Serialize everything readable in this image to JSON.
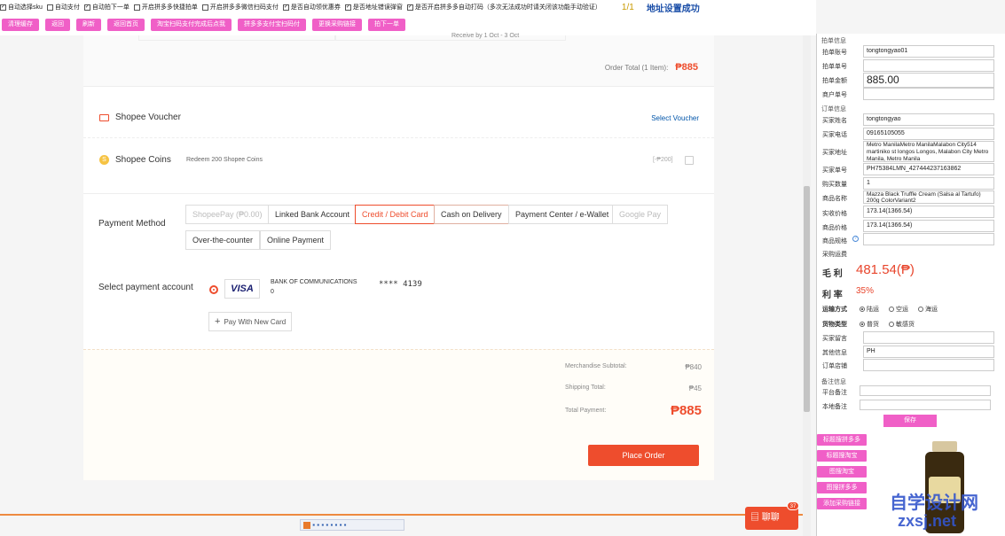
{
  "toolbar": {
    "checkboxes": [
      {
        "label": "自动选择sku",
        "checked": true
      },
      {
        "label": "自动支付",
        "checked": false
      },
      {
        "label": "自动拍下一单",
        "checked": true
      },
      {
        "label": "开启拼多多快捷拍单",
        "checked": false
      },
      {
        "label": "开启拼多多微信扫码支付",
        "checked": false
      },
      {
        "label": "是否自动领优惠券",
        "checked": true
      },
      {
        "label": "是否地址错误弹窗",
        "checked": true
      },
      {
        "label": "是否开启拼多多自动打码（多次无法成功时请关闭该功能手动验证）",
        "checked": true
      }
    ],
    "pager": "1/1",
    "address_status": "地址设置成功",
    "buttons": [
      "清理缓存",
      "返回",
      "刷新",
      "返回首页",
      "淘宝扫码支付完成后点我",
      "拼多多支付宝扫码付",
      "更换采购链接",
      "拍下一单"
    ]
  },
  "order": {
    "receive_text": "Receive by 1 Oct - 3 Oct",
    "order_total_label": "Order Total (1 Item):",
    "order_total_value": "₱885"
  },
  "voucher": {
    "label": "Shopee Voucher",
    "action": "Select Voucher"
  },
  "coins": {
    "label": "Shopee Coins",
    "desc": "Redeem 200 Shopee Coins",
    "value": "[-₱200]"
  },
  "payment": {
    "label": "Payment Method",
    "methods": [
      "ShopeePay (₱0.00)",
      "Linked Bank Account",
      "Credit / Debit Card",
      "Cash on Delivery",
      "Payment Center / e-Wallet",
      "Google Pay",
      "Over-the-counter",
      "Online Payment"
    ],
    "account_label": "Select payment account",
    "card_brand": "VISA",
    "bank_name": "BANK OF COMMUNICATIONS",
    "bank_sub": "0",
    "card_number": "**** 4139",
    "new_card": "Pay With New Card"
  },
  "summary": {
    "merch_label": "Merchandise Subtotal:",
    "merch_value": "₱840",
    "ship_label": "Shipping Total:",
    "ship_value": "₱45",
    "total_label": "Total Payment:",
    "total_value": "₱885",
    "place_order": "Place Order"
  },
  "panel": {
    "sec_order": "拍单信息",
    "account_label": "拍单账号",
    "account_value": "tongtongyao01",
    "order_no_label": "拍单单号",
    "order_no_value": "",
    "amount_label": "拍单金额",
    "amount_value": "885.00",
    "merchant_label": "商户单号",
    "merchant_value": "",
    "sec_buyer": "订单信息",
    "buyer_name_label": "买家姓名",
    "buyer_name_value": "tongtongyao",
    "buyer_phone_label": "买家电话",
    "buyer_phone_value": "09165105055",
    "buyer_addr_label": "买家地址",
    "buyer_addr_value": "Metro ManilaMetro ManilaMalabon City514 martiniko st longos Longos, Malabon City Metro Manila, Metro Manila",
    "buyer_no_label": "买家单号",
    "buyer_no_value": "PH75384LMN_427444237163862",
    "qty_label": "购买数量",
    "qty_value": "1",
    "product_label": "商品名称",
    "product_value": "Mazza Black Truffle Cream (Salsa al Tartufo) 200g ColorVariant2",
    "actual_label": "实收价格",
    "actual_value": "173.14(1366.54)",
    "price_label": "商品价格",
    "price_value": "173.14(1366.54)",
    "spec_label": "商品规格",
    "spec_value": "",
    "freight_label": "采购运费",
    "profit_label": "毛 利",
    "profit_value": "481.54(₱)",
    "rate_label": "利 率",
    "rate_value": "35%",
    "ship_label": "运输方式",
    "ship_options": [
      "陆运",
      "空运",
      "海运"
    ],
    "goods_label": "货物类型",
    "goods_options": [
      "普货",
      "敏感货"
    ],
    "buyer_note_label": "买家留言",
    "buyer_note_value": "",
    "other_label": "其他信息",
    "other_value": "PH",
    "shop_label": "订单店铺",
    "shop_value": "",
    "sec_note": "备注信息",
    "platform_note_label": "平台备注",
    "platform_note_value": "",
    "local_note_label": "本地备注",
    "local_note_value": "",
    "save": "保存",
    "side_buttons": [
      "标题搜拼多多",
      "标题搜淘宝",
      "图搜淘宝",
      "图搜拼多多",
      "添加采购链接"
    ]
  },
  "chat": {
    "label": "聊聊",
    "badge": "37"
  },
  "watermark": {
    "line1": "自学设计网",
    "line2": "zxsj.net"
  }
}
